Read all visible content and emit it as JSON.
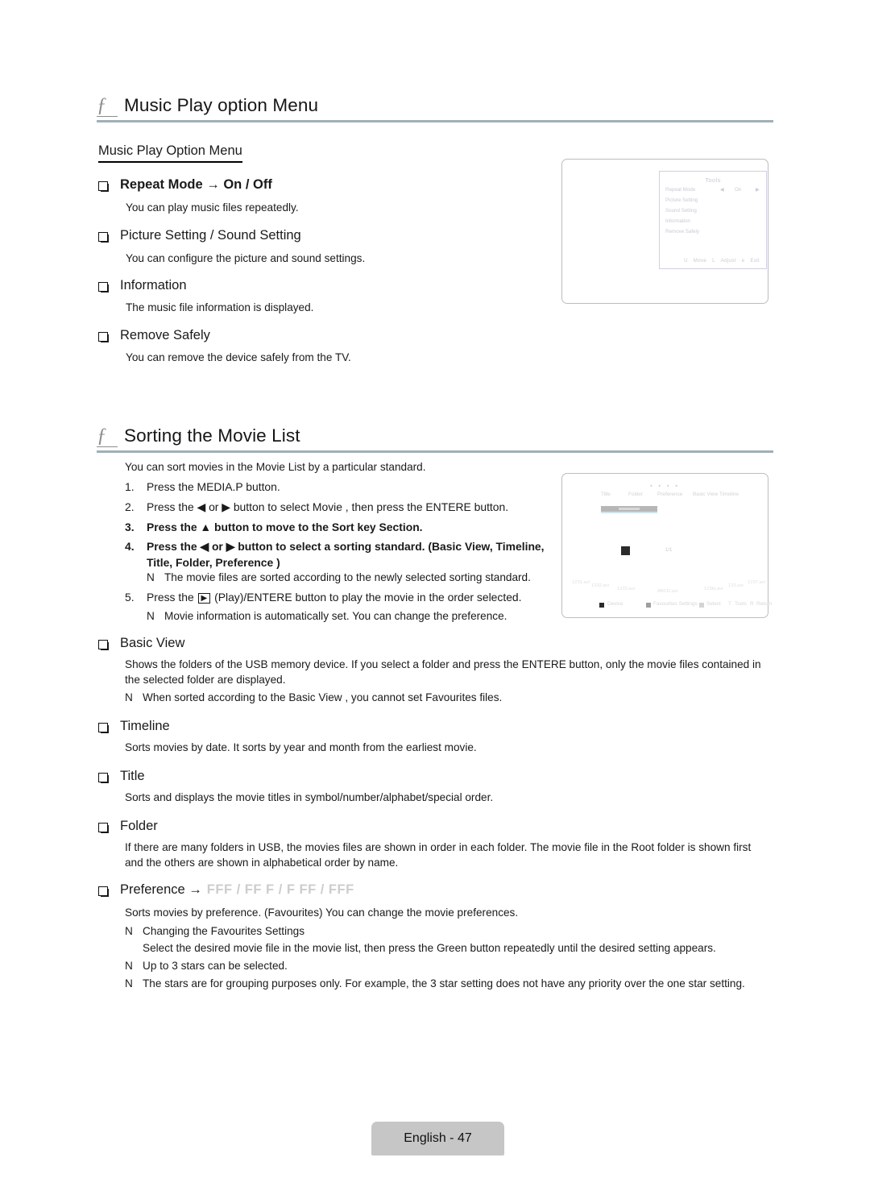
{
  "page": {
    "footer_label": "English - 47"
  },
  "section1": {
    "f_glyph": "ƒ",
    "title": "Music Play option Menu",
    "subhead": "Music Play Option Menu",
    "items": [
      {
        "label": "Repeat Mode → On / Off",
        "desc": "You can play music files repeatedly.",
        "bold": true
      },
      {
        "label": "Picture Setting / Sound Setting",
        "desc": "You can configure the picture and sound settings.",
        "bold": false
      },
      {
        "label": "Information",
        "desc": "The music file information is displayed.",
        "bold": false
      },
      {
        "label": "Remove Safely",
        "desc": "You can remove the device safely from the TV.",
        "bold": false
      }
    ]
  },
  "tools_screen": {
    "title": "Tools",
    "rows": [
      {
        "label": "Repeat Mode",
        "value": "On",
        "left_arrow": "◀",
        "right_arrow": "▶"
      },
      {
        "label": "Picture Setting",
        "value": "",
        "left_arrow": "",
        "right_arrow": ""
      },
      {
        "label": "Sound Setting",
        "value": "",
        "left_arrow": "",
        "right_arrow": ""
      },
      {
        "label": "Information",
        "value": "",
        "left_arrow": "",
        "right_arrow": ""
      },
      {
        "label": "Remove Safely",
        "value": "",
        "left_arrow": "",
        "right_arrow": ""
      }
    ],
    "footer": [
      {
        "key": "U",
        "action": "Move"
      },
      {
        "key": "L",
        "action": "Adjust"
      },
      {
        "key": "e",
        "action": "Exit"
      }
    ]
  },
  "section2": {
    "f_glyph": "ƒ",
    "title": "Sorting the Movie List",
    "intro": "You can sort movies in the Movie List by a particular standard.",
    "steps": [
      {
        "num": "1.",
        "text": "Press the MEDIA.P button.",
        "bold": false
      },
      {
        "num": "2.",
        "text": "Press the ◀ or ▶ button to select Movie , then press the ENTERE    button.",
        "bold": false
      },
      {
        "num": "3.",
        "text": "Press the ▲ button to move to the Sort key Section.",
        "bold": true
      },
      {
        "num": "4.",
        "text": "Press the ◀ or ▶ button to select a sorting standard. (Basic View, Timeline,",
        "text2": "Title, Folder, Preference  )",
        "bold": true
      },
      {
        "num": "5.",
        "text_pre": "Press the ",
        "key": "▶",
        "text_post": " (Play)/ENTERE    button to play the movie in the order selected.",
        "bold": false
      }
    ],
    "step_notes": [
      {
        "after": "4",
        "mark": "N",
        "text": "The movie files are sorted according to the newly selected sorting standard."
      },
      {
        "after": "5",
        "mark": "N",
        "text": "Movie information is automatically set. You can change the preference."
      }
    ]
  },
  "movielist_screen": {
    "dots": "▪ ▪ ▪ ▪",
    "sort_tabs": [
      "Title",
      "Folder",
      "Preference",
      "Basic View",
      "Timeline"
    ],
    "page_indicator": "1/1",
    "files": [
      "1231.avi",
      "1232.avi",
      "1233.avi",
      "ABCD.avi",
      "123fa.avi",
      "123.avi",
      "1237.avi"
    ],
    "bottom_bar": [
      {
        "icon": "black-square",
        "label": "Device"
      },
      {
        "icon": "gray-square",
        "label": "Favourites Settings"
      },
      {
        "icon": "light-square",
        "label": "Select"
      },
      {
        "icon": "T",
        "label": "Tools"
      },
      {
        "icon": "R",
        "label": "Return"
      }
    ]
  },
  "section3": {
    "items": [
      {
        "label": "Basic View",
        "desc": "Shows the folders of the USB memory device. If you select a folder and press the ENTERE    button, only the movie files contained in the selected folder are displayed.",
        "notes": [
          {
            "mark": "N",
            "text": "When sorted according to the Basic View , you cannot set Favourites files."
          }
        ]
      },
      {
        "label": "Timeline",
        "desc": "Sorts movies by date. It sorts by year and month from the earliest movie.",
        "notes": []
      },
      {
        "label": "Title",
        "desc": "Sorts and displays the movie titles in symbol/number/alphabet/special order.",
        "notes": []
      },
      {
        "label": "Folder",
        "desc": "If there are many folders in USB, the movies files are shown in order in each folder. The movie file in the Root folder is shown first and the others are shown in alphabetical order by name.",
        "notes": []
      }
    ],
    "preference": {
      "label": "Preference →",
      "stars": "FFF    / FF   F  / F  FF   / FFF",
      "desc": "Sorts movies by preference. (Favourites) You can change the movie preferences.",
      "notes": [
        {
          "mark": "N",
          "text": "Changing the Favourites Settings"
        },
        {
          "mark": "",
          "text": "Select the desired movie file in the movie list, then press the Green button repeatedly until the desired setting appears."
        },
        {
          "mark": "N",
          "text": "Up to 3 stars can be selected."
        },
        {
          "mark": "N",
          "text": "The stars are for grouping purposes only. For example, the 3 star setting does not have any priority over the one star setting."
        }
      ]
    }
  }
}
